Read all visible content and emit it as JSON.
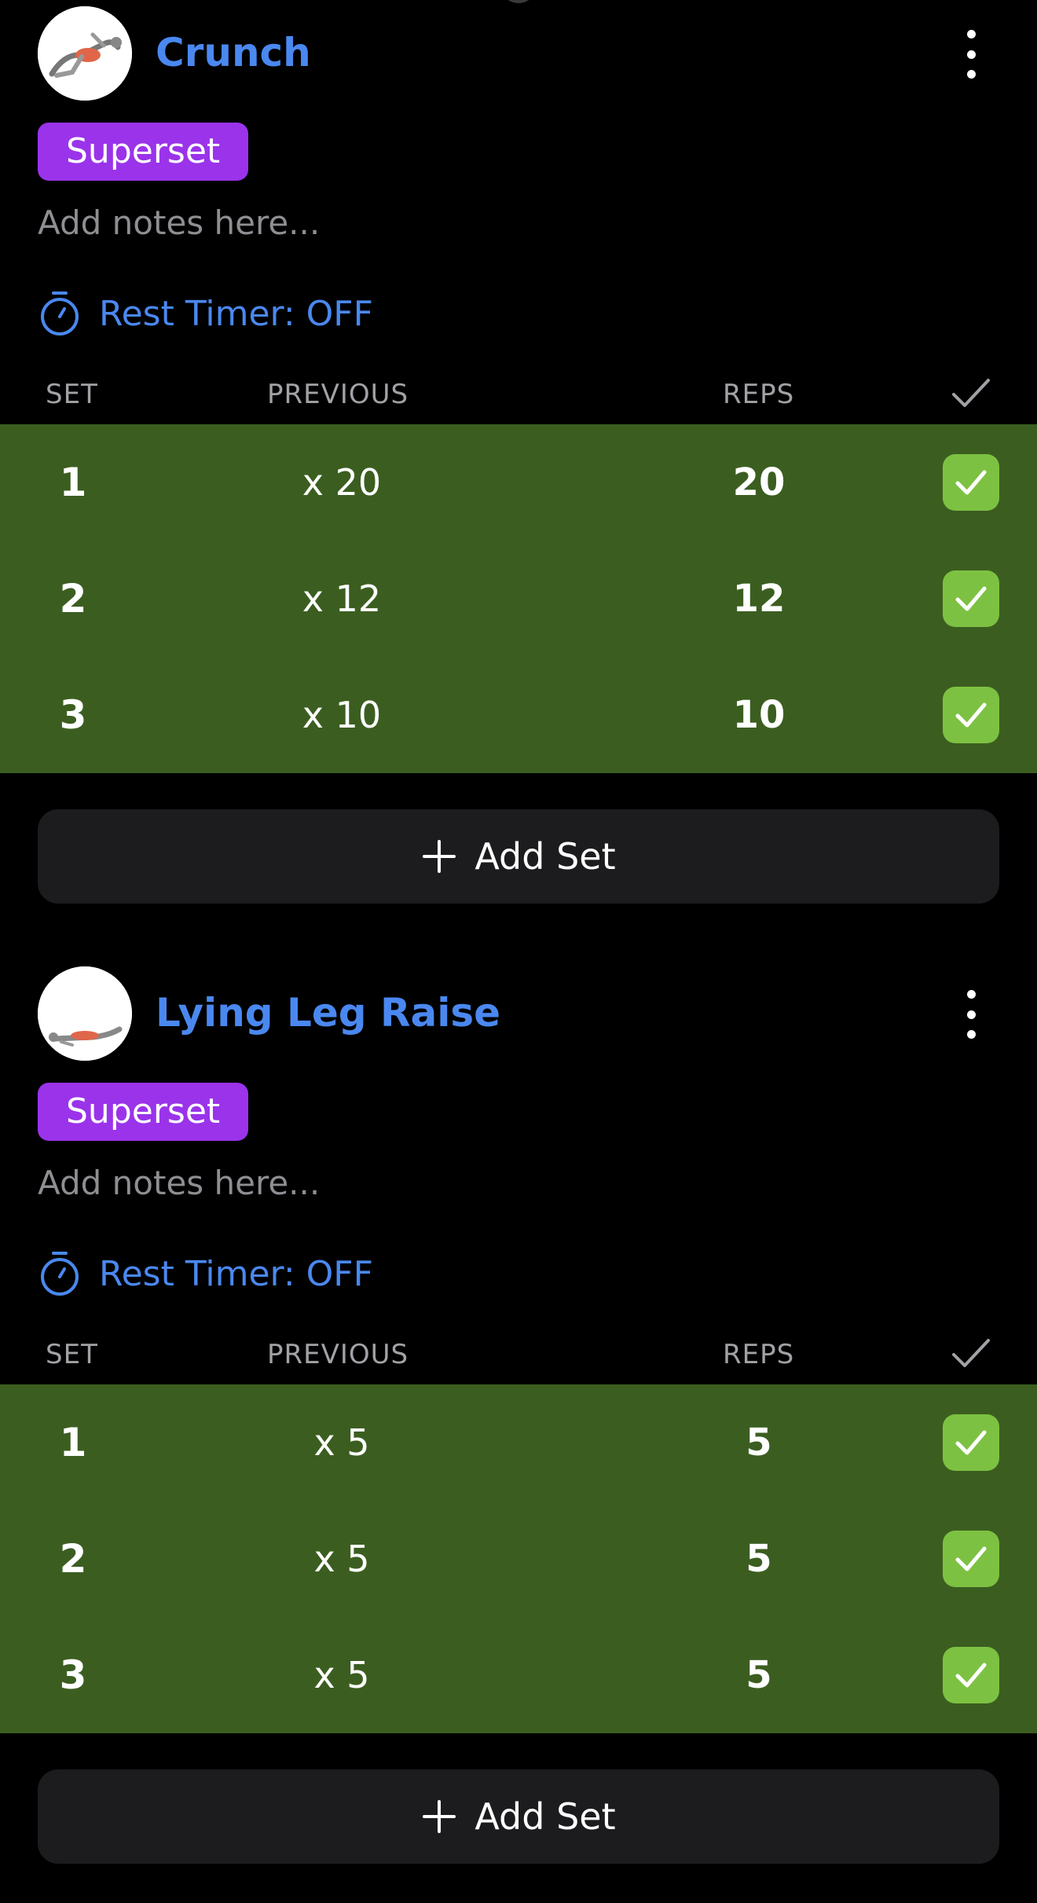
{
  "exercises": [
    {
      "name": "Crunch",
      "image_icon": "crunch-exercise-thumbnail",
      "badge": "Superset",
      "notes_placeholder": "Add notes here...",
      "rest_timer": "Rest Timer: OFF",
      "columns": {
        "set": "SET",
        "previous": "PREVIOUS",
        "reps": "REPS",
        "done_icon": "check-icon"
      },
      "sets": [
        {
          "set": "1",
          "previous": "x 20",
          "reps": "20",
          "completed": true
        },
        {
          "set": "2",
          "previous": "x 12",
          "reps": "12",
          "completed": true
        },
        {
          "set": "3",
          "previous": "x 10",
          "reps": "10",
          "completed": true
        }
      ],
      "add_set_label": "Add Set"
    },
    {
      "name": "Lying Leg Raise",
      "image_icon": "leg-raise-exercise-thumbnail",
      "badge": "Superset",
      "notes_placeholder": "Add notes here...",
      "rest_timer": "Rest Timer: OFF",
      "columns": {
        "set": "SET",
        "previous": "PREVIOUS",
        "reps": "REPS",
        "done_icon": "check-icon"
      },
      "sets": [
        {
          "set": "1",
          "previous": "x 5",
          "reps": "5",
          "completed": true
        },
        {
          "set": "2",
          "previous": "x 5",
          "reps": "5",
          "completed": true
        },
        {
          "set": "3",
          "previous": "x 5",
          "reps": "5",
          "completed": true
        }
      ],
      "add_set_label": "Add Set"
    }
  ],
  "colors": {
    "background": "#000000",
    "accent_blue": "#4a88f0",
    "superset_purple": "#9a33ea",
    "completed_row_green": "#3b5e20",
    "check_green": "#7dc142",
    "button_dark": "#1c1c1e"
  }
}
